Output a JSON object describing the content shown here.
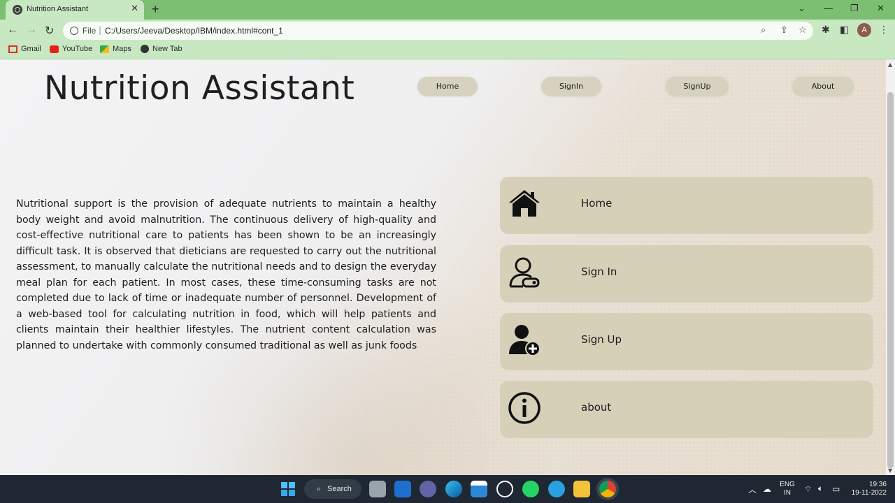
{
  "browser": {
    "tab_title": "Nutrition Assistant",
    "tab_close": "✕",
    "new_tab": "+",
    "file_label": "File",
    "url": "C:/Users/Jeeva/Desktop/IBM/index.html#cont_1",
    "avatar_letter": "A",
    "window_controls": [
      "⌄",
      "—",
      "❐",
      "✕"
    ],
    "bookmarks": [
      {
        "label": "Gmail",
        "icon": "gmail-icon",
        "color": "#d93025"
      },
      {
        "label": "YouTube",
        "icon": "youtube-icon",
        "color": "#e62117"
      },
      {
        "label": "Maps",
        "icon": "maps-icon",
        "color": "#34a853"
      },
      {
        "label": "New Tab",
        "icon": "globe-icon",
        "color": "#333333"
      }
    ]
  },
  "page": {
    "title": "Nutrition Assistant",
    "nav": [
      "Home",
      "SignIn",
      "SignUp",
      "About"
    ],
    "intro": "Nutritional support is the provision of adequate nutrients to maintain a healthy body weight and avoid malnutrition. The continuous delivery of high-quality and cost-effective nutritional care to patients has been shown to be an increasingly difficult task. It is observed that dieticians are requested to carry out the nutritional assessment, to manually calculate the nutritional needs and to design the everyday meal plan for each patient. In most cases, these time-consuming tasks are not completed due to lack of time or inadequate number of personnel. Development of a web-based tool for calculating nutrition in food, which will help patients and clients maintain their healthier lifestyles. The nutrient content calculation was planned to undertake with commonly consumed traditional as well as junk foods",
    "cards": [
      {
        "label": "Home",
        "icon": "home-icon"
      },
      {
        "label": "Sign In",
        "icon": "user-login-icon"
      },
      {
        "label": "Sign Up",
        "icon": "user-add-icon"
      },
      {
        "label": "about",
        "icon": "info-icon"
      }
    ],
    "card_color": "#d6d0b9"
  },
  "taskbar": {
    "search_label": "Search",
    "lang_top": "ENG",
    "lang_bottom": "IN",
    "time": "19:36",
    "date": "19-11-2022"
  }
}
